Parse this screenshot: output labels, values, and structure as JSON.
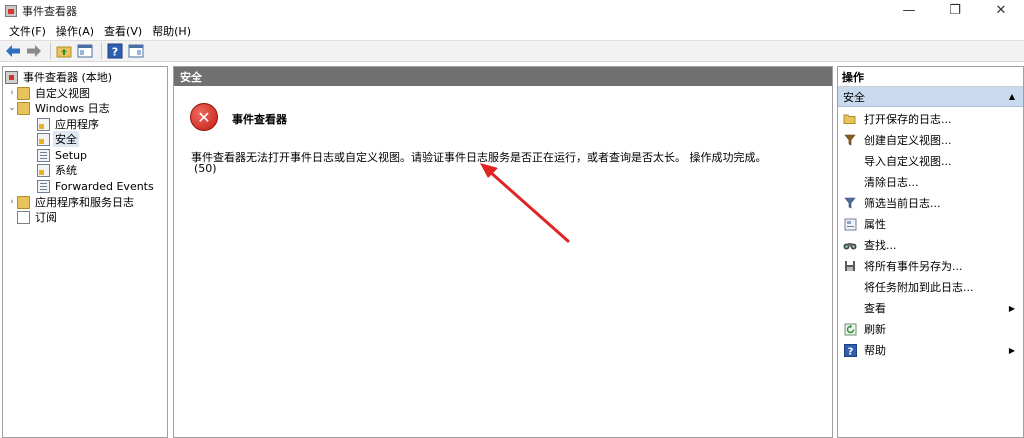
{
  "window": {
    "title": "事件查看器",
    "minimize": "—",
    "restore": "❐",
    "close": "✕"
  },
  "menu": [
    "文件(F)",
    "操作(A)",
    "查看(V)",
    "帮助(H)"
  ],
  "tree": {
    "root": "事件查看器 (本地)",
    "custom_views": "自定义视图",
    "windows_logs": "Windows 日志",
    "application": "应用程序",
    "security": "安全",
    "setup": "Setup",
    "system": "系统",
    "forwarded": "Forwarded Events",
    "apps_services": "应用程序和服务日志",
    "subscriptions": "订阅"
  },
  "center": {
    "header": "安全",
    "error_title": "事件查看器",
    "error_message": "事件查看器无法打开事件日志或自定义视图。请验证事件日志服务是否正在运行，或者查询是否太长。 操作成功完成。",
    "error_code": "(50)"
  },
  "actions": {
    "header": "操作",
    "section": "安全",
    "items": [
      {
        "label": "打开保存的日志...",
        "icon": "folder-open-icon"
      },
      {
        "label": "创建自定义视图...",
        "icon": "filter-icon"
      },
      {
        "label": "导入自定义视图...",
        "icon": ""
      },
      {
        "label": "清除日志...",
        "icon": ""
      },
      {
        "label": "筛选当前日志...",
        "icon": "filter-icon"
      },
      {
        "label": "属性",
        "icon": "properties-icon"
      },
      {
        "label": "查找...",
        "icon": "binoculars-icon"
      },
      {
        "label": "将所有事件另存为...",
        "icon": "save-icon"
      },
      {
        "label": "将任务附加到此日志...",
        "icon": ""
      },
      {
        "label": "查看",
        "icon": ""
      },
      {
        "label": "刷新",
        "icon": "refresh-icon"
      },
      {
        "label": "帮助",
        "icon": "help-icon"
      }
    ]
  },
  "colors": {
    "header_gray": "#707070",
    "section_blue": "#c9d9ee",
    "arrow_red": "#e02424",
    "error_red": "#c11d14"
  }
}
